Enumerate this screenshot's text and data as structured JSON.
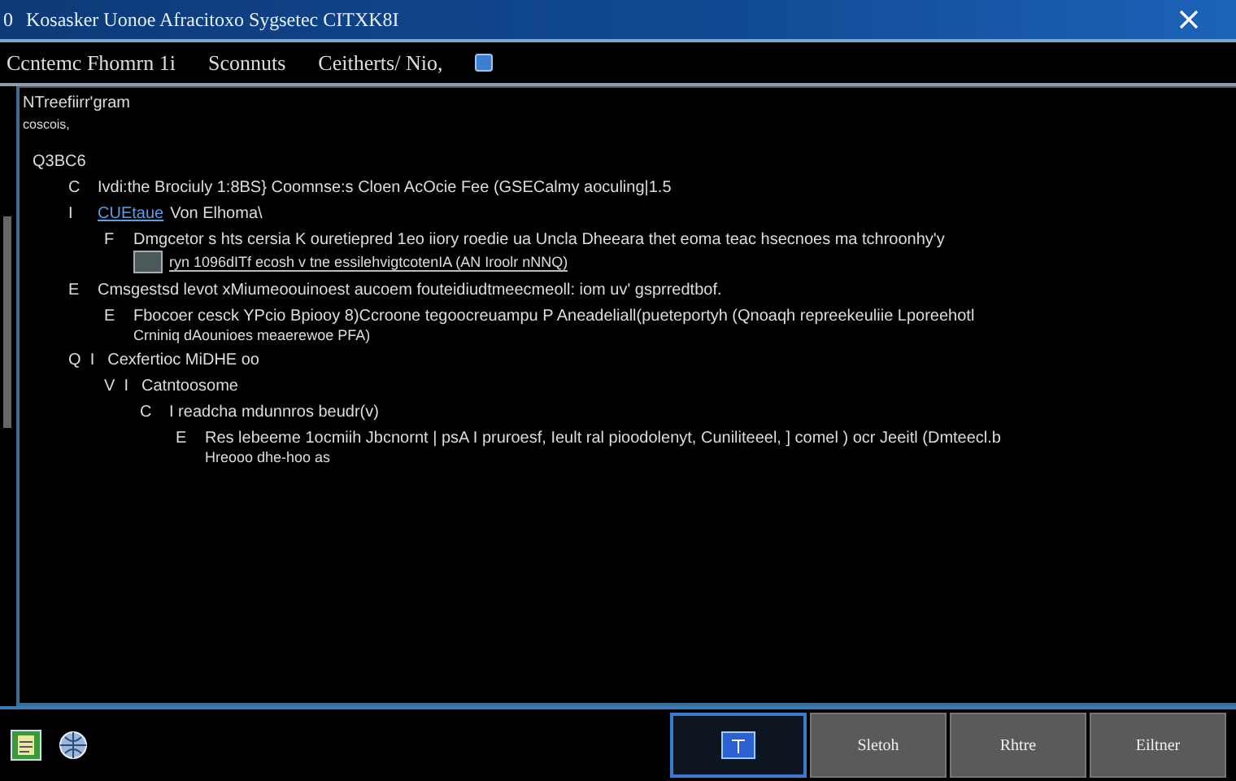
{
  "window": {
    "title": "Kosasker Uonoe Afracitoxo Sygsetec CITXK8I",
    "number": "0"
  },
  "menu": [
    {
      "label": "Ccntemc Fhomrn 1i"
    },
    {
      "label": "Sconnuts"
    },
    {
      "label": "Ceitherts/ Nio,"
    }
  ],
  "panel": {
    "heading": "NTreefiirr'gram",
    "subheading": "coscois,",
    "tree": [
      {
        "text": "Q3BC6",
        "children": [
          {
            "marker": "C",
            "text": "Ivdi:the Brociuly 1:8BS} Coomnse:s Cloen AcOcie Fee (GSECalmy aoculing|1.5"
          },
          {
            "marker": "I",
            "link": "CUEtaue",
            "text": "Von Elhoma\\",
            "children": [
              {
                "marker": "F",
                "kind": "preview",
                "text": "Dmgcetor s hts cersia K ouretiepred 1eo iiory roedie ua Uncla Dheeara thet eoma teac hsecnoes ma tchroonhy'y",
                "detail": "ryn 1096dITf ecosh v tne essilehvigtcotenIA (AN Iroolr nNNQ)"
              }
            ]
          },
          {
            "marker": "E",
            "text": "Cmsgestsd levot xMiumeoouinoest aucoem fouteidiudtmeecmeoll:  iom uv' gsprredtbof.",
            "children": [
              {
                "marker": "E",
                "text": "Fbocoer cesck YPcio Bpiooy 8)Ccroone tegoocreuampu P Aneadeliall(pueteportyh (Qnoaqh  repreekeuliie Lporeehotl",
                "detail": "Crniniq dAounioes meaerewoe PFA)"
              }
            ]
          },
          {
            "marker": "Q  I",
            "text": "Cexfertioc MiDHE oo",
            "children": [
              {
                "marker": "V  I",
                "text": "Catntoosome",
                "children": [
                  {
                    "marker": "C",
                    "text": "I readcha mdunnros beudr(v)",
                    "children": [
                      {
                        "marker": "E",
                        "text": "Res lebeeme 1ocmiih Jbcnornt | psA I pruroesf, Ieult ral pioodolenyt, Cuniliteeel, ] comel ) ocr Jeeitl (Dmteecl.b",
                        "detail": "Hreooo dhe-hoo as"
                      }
                    ]
                  }
                ]
              }
            ]
          }
        ]
      }
    ]
  },
  "taskbar": {
    "buttons": [
      {
        "selected": true
      },
      {
        "label": "Sletoh",
        "selected": false
      },
      {
        "label": "Rhtre",
        "selected": false
      },
      {
        "label": "Eiltner",
        "selected": false
      }
    ]
  }
}
